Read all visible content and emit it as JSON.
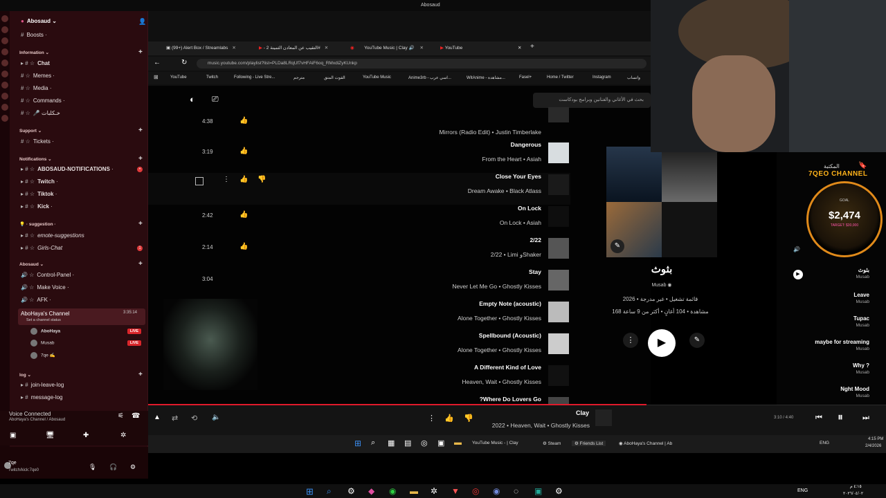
{
  "window": {
    "title": "Abosaud"
  },
  "discord": {
    "server_name": "Abosaud",
    "categories": [
      {
        "label": "Information",
        "channels": [
          "Chat",
          "Memes",
          "Media",
          "Commands",
          "🎤 خـكلبات"
        ]
      },
      {
        "label": "Support",
        "channels": [
          "Tickets"
        ]
      },
      {
        "label": "Notifications",
        "channels": [
          "ABOSAUD-NOTIFICATIONS",
          "Twitch",
          "Tiktok",
          "Kick"
        ]
      },
      {
        "label": "suggestion",
        "channels": [
          "emote-suggestions",
          "Girls-Chat"
        ]
      },
      {
        "label": "Abosaud",
        "channels": [
          "Control-Panel",
          "Make Voice",
          "AFK"
        ]
      },
      {
        "label": "log",
        "channels": [
          "join-leave-log",
          "message-log"
        ]
      }
    ],
    "boosts": "Boosts",
    "voice_channel": {
      "name": "AboHaya's Channel",
      "status": "Set a channel status",
      "timer": "3:35:14"
    },
    "voice_users": [
      {
        "name": "AboHaya",
        "live": "LIVE"
      },
      {
        "name": "Musab",
        "live": "LIVE"
      },
      {
        "name": "7qe",
        "live": ""
      }
    ],
    "voice_connected": {
      "title": "Voice Connected",
      "sub": "AboHaya's Channel / Abosaud"
    },
    "user": {
      "name": "7qe",
      "status": "Twitch/kick:7qe0"
    }
  },
  "browser": {
    "tabs": [
      {
        "label": "(99+) Alert Box / Streamlabs"
      },
      {
        "label": "التقيب عن المعادن الثمينة 2#"
      },
      {
        "label": "YouTube Music | Clay"
      },
      {
        "label": "YouTube"
      }
    ],
    "url": "music.youtube.com/playlist?list=PLDa8LRqUf7vHFAiF6oq_RMxdiZyKUnkp",
    "bookmarks": [
      "YouTube",
      "Twitch",
      "Following - Live Stre...",
      "مترجم",
      "القوت المتق",
      "YouTube Music",
      "Anime3rb - اسي عرب...",
      "WitAnime - مشاهدة...",
      "Fasel+",
      "Home / Twitter",
      "Instagram",
      "واتساب"
    ],
    "search_placeholder": "بحث في الأغاني والفنانين وبرامج بودكاست"
  },
  "tracks": [
    {
      "duration": "4:38",
      "title": "",
      "sub": "Mirrors (Radio Edit) • Justin Timberlake"
    },
    {
      "duration": "3:19",
      "title": "Dangerous",
      "sub": "From the Heart • Asiah"
    },
    {
      "duration": "",
      "title": "Close Your Eyes",
      "sub": "Dream Awake • Black Atlass"
    },
    {
      "duration": "2:42",
      "title": "On Lock",
      "sub": "On Lock • Asiah"
    },
    {
      "duration": "2:14",
      "title": "2/22",
      "sub": "2/22 • Limi وShaker"
    },
    {
      "duration": "3:04",
      "title": "Stay",
      "sub": "Never Let Me Go • Ghostly Kisses"
    },
    {
      "duration": "",
      "title": "Empty Note (acoustic)",
      "sub": "Alone Together • Ghostly Kisses"
    },
    {
      "duration": "",
      "title": "Spellbound (Acoustic)",
      "sub": "Alone Together • Ghostly Kisses"
    },
    {
      "duration": "",
      "title": "A Different Kind of Love",
      "sub": "Heaven, Wait • Ghostly Kisses"
    },
    {
      "duration": "",
      "title": "?Where Do Lovers Go",
      "sub": ""
    }
  ],
  "playlist": {
    "title": "بثوث",
    "owner": "Musab",
    "meta1": "2026 • قائمة تشغيل • غير مدرجة",
    "meta2": "168 مشاهدة • 104 أغانٍ • أكثر من 9 ساعة"
  },
  "queue": [
    {
      "title": "بثوث",
      "sub": "Musab"
    },
    {
      "title": "Leave",
      "sub": "Musab"
    },
    {
      "title": "Tupac",
      "sub": "Musab"
    },
    {
      "title": "maybe for streaming",
      "sub": "Musab"
    },
    {
      "title": "Why ?",
      "sub": "Musab"
    },
    {
      "title": "Nght Mood",
      "sub": "Musab"
    }
  ],
  "library_label": "المكتبة",
  "overlay": {
    "channel": "7QEO CHANNEL",
    "goal_label": "GOAL",
    "amount": "$2,474",
    "target": "TARGET: $30,000"
  },
  "player": {
    "title": "Clay",
    "sub": "2022 • Heaven, Wait • Ghostly Kisses",
    "time": "3:10 / 4:40"
  },
  "inner_taskbar": {
    "apps": [
      "YouTube Music - ‏| Clay",
      "Steam",
      "Friends List",
      "AboHaya's Channel | Ab"
    ],
    "lang": "ENG",
    "clock": "4:15 PM",
    "date": "2/4/2026"
  },
  "main_taskbar": {
    "lang": "ENG",
    "clock": "٤:١٥ م",
    "date": "٢٠٢٦/٠٤/٠٢"
  },
  "colors": {
    "accent": "#e01a2b",
    "discord_bg": "#2a0b0f",
    "overlay": "#e08a1a",
    "live": "#d9262b"
  }
}
